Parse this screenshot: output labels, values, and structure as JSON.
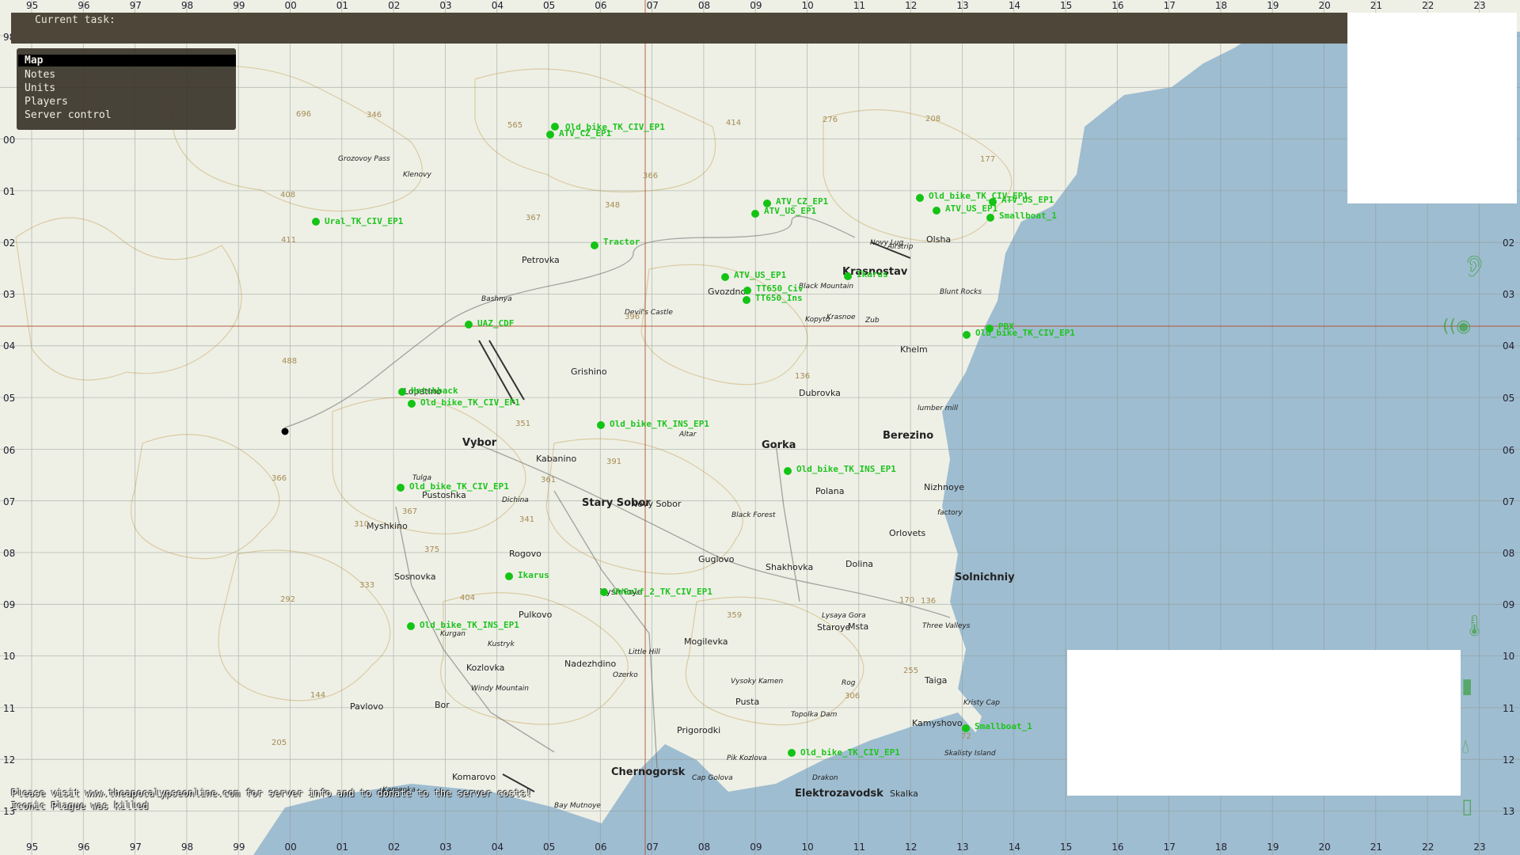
{
  "taskbar": {
    "label": "Current task:"
  },
  "menu": {
    "items": [
      "Map",
      "Notes",
      "Units",
      "Players",
      "Server control"
    ],
    "selected": "Map"
  },
  "grid": {
    "top_labels": [
      "95",
      "96",
      "97",
      "98",
      "99",
      "00",
      "01",
      "02",
      "03",
      "04",
      "05",
      "06",
      "07",
      "08",
      "09",
      "10",
      "11",
      "12",
      "13",
      "14",
      "15",
      "16",
      "17",
      "18",
      "19",
      "20",
      "21",
      "22",
      "23"
    ],
    "left_labels": [
      "98",
      "00",
      "01",
      "02",
      "03",
      "04",
      "05",
      "06",
      "07",
      "08",
      "09",
      "10",
      "11",
      "12",
      "13"
    ],
    "right_labels": [
      "02",
      "03",
      "04",
      "05",
      "06",
      "07",
      "08",
      "09",
      "10",
      "11",
      "12",
      "13"
    ]
  },
  "units": [
    "Old_bike_TK_CIV_EP1",
    "ATV_CZ_EP1",
    "Ural_TK_CIV_EP1",
    "Tractor",
    "ATV_CZ_EP1",
    "ATV_US_EP1",
    "Old_bike_TK_CIV_EP1",
    "ATV_US_EP1",
    "ATV_US_EP1",
    "Smallboat_1",
    "ATV_US_EP1",
    "TT650_Civ",
    "TT650_Ins",
    "Ikarus",
    "UAZ_CDF",
    "Old_bike_TK_CIV_EP1",
    "Hatchback",
    "Old_bike_TK_CIV_EP1",
    "Old_bike_TK_INS_EP1",
    "Old_bike_TK_INS_EP1",
    "Old_bike_TK_CIV_EP1",
    "Ikarus",
    "VWGolf_2_TK_CIV_EP1",
    "Old_bike_TK_INS_EP1",
    "Smallboat_1",
    "Old_bike_TK_CIV_EP1",
    "PBX"
  ],
  "places": {
    "large": [
      "Vybor",
      "Stary Sobor",
      "Gorka",
      "Berezino",
      "Solnichniy",
      "Chernogorsk",
      "Elektrozavodsk",
      "Krasnostav"
    ],
    "medium": [
      "Petrovka",
      "Grishino",
      "Kabanino",
      "Rogovo",
      "Sosnovka",
      "Pustoshka",
      "Myshkino",
      "Pavlovo",
      "Bor",
      "Kozlovka",
      "Pulkovo",
      "Mogilevka",
      "Nadezhdino",
      "Guglovo",
      "Shakhovka",
      "Dolina",
      "Polana",
      "Orlovets",
      "Nizhnoye",
      "Dubrovka",
      "Khelm",
      "Olsha",
      "Gvozdno",
      "Staroye",
      "Msta",
      "Pusta",
      "Prigorodki",
      "Kamyshovo",
      "Komarovo",
      "Taiga",
      "Skalka",
      "Lopatino",
      "Novy Sobor",
      "Vyshnoye"
    ],
    "small": [
      "Skalisty Island",
      "Kamenka",
      "Bay Mutnoye",
      "Topolka Dam",
      "Cap Golova",
      "Drakon",
      "Three Valleys",
      "Kristy Cap",
      "factory",
      "lumber mill",
      "Black Forest",
      "Devil's Castle",
      "Blunt Rocks",
      "Black Mountain",
      "Kopyto",
      "Novy Lug",
      "Airstrip",
      "Grozovoy Pass",
      "Klenovy",
      "Altar",
      "Pik Kozlova",
      "Little Hill",
      "Windy Mountain",
      "Vysoky Kamen",
      "Lysaya Gora",
      "Kustryk",
      "Bashnya",
      "Kurgan",
      "Zub",
      "Dichina",
      "Rog",
      "Ozerko",
      "Krasnoe",
      "Tulga"
    ]
  },
  "elevations": [
    "696",
    "346",
    "565",
    "414",
    "276",
    "208",
    "177",
    "408",
    "367",
    "348",
    "411",
    "366",
    "396",
    "488",
    "136",
    "351",
    "391",
    "361",
    "341",
    "366",
    "367",
    "375",
    "404",
    "359",
    "292",
    "310",
    "333",
    "170",
    "136",
    "255",
    "306",
    "144",
    "205",
    "72"
  ],
  "chat": [
    "Please visit www.theapocalypseonline.com for server info and to donate to the server costs!",
    "Iconic Plague was killed"
  ],
  "colors": {
    "land": "#eef0e6",
    "sea": "#9fbdd0",
    "contour": "#d8c79a",
    "grid": "#8a8f86",
    "unit": "#14c414",
    "taskbar": "#4e4639"
  },
  "icons": [
    "ear-icon",
    "eye-icon",
    "thermometer-icon",
    "food-icon",
    "water-drop-icon",
    "canteen-icon"
  ]
}
